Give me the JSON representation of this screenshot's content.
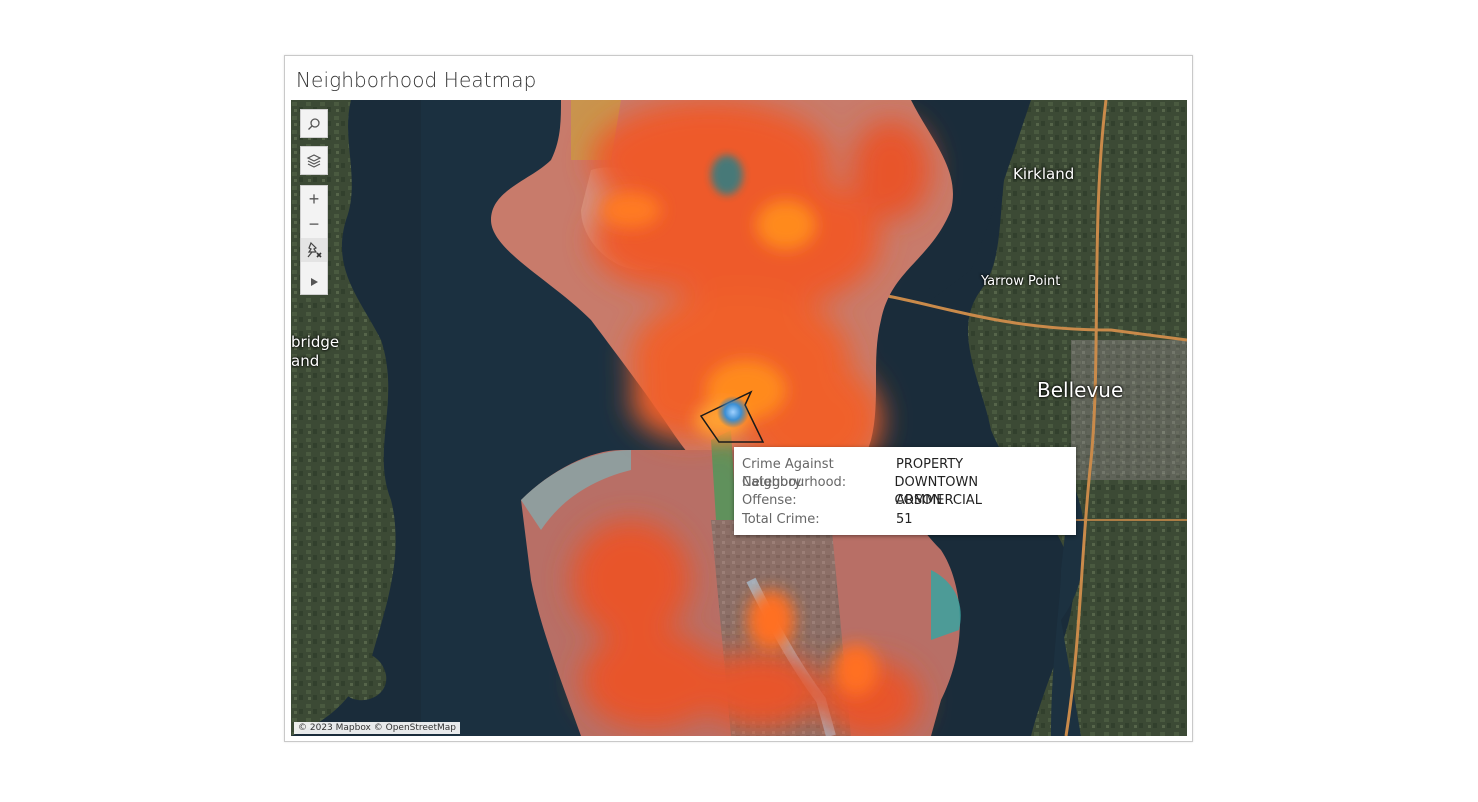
{
  "dashboard": {
    "title": "Neighborhood Heatmap"
  },
  "map": {
    "places": {
      "kirkland": "Kirkland",
      "yarrow_point": "Yarrow Point",
      "bellevue": "Bellevue",
      "bainbridge_line1": "bridge",
      "bainbridge_line2": "and"
    },
    "controls": {
      "search": "search-icon",
      "layers": "layers-icon",
      "zoom_in": "+",
      "zoom_out": "−",
      "pin": "pin-clear-icon",
      "expand": "play-icon"
    },
    "attribution": "© 2023 Mapbox © OpenStreetMap",
    "colors": {
      "heat_core": "#ff8a1f",
      "heat_mid": "#f05a28",
      "selected": "#3b8fd4",
      "water": "#1a2c3a"
    }
  },
  "tooltip": {
    "rows": [
      {
        "key": "Crime Against Category:",
        "value": "PROPERTY"
      },
      {
        "key": "Neighbourhood:",
        "value": "DOWNTOWN COMMERCIAL"
      },
      {
        "key": "Offense:",
        "value": "ARSON"
      },
      {
        "key": "Total Crime:",
        "value": "51"
      }
    ]
  }
}
